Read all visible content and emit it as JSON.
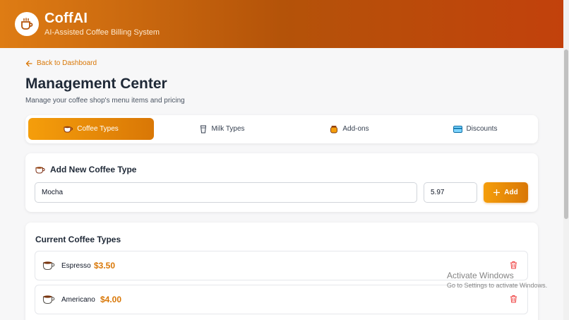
{
  "header": {
    "title": "CoffAI",
    "subtitle": "AI-Assisted Coffee Billing System",
    "logo_icon": "coffee-cup-icon"
  },
  "nav": {
    "back_label": "Back to Dashboard"
  },
  "page": {
    "title": "Management Center",
    "subtitle": "Manage your coffee shop's menu items and pricing"
  },
  "tabs": [
    {
      "label": "Coffee Types",
      "icon": "coffee-icon",
      "active": true
    },
    {
      "label": "Milk Types",
      "icon": "milk-icon",
      "active": false
    },
    {
      "label": "Add-ons",
      "icon": "honey-pot-icon",
      "active": false
    },
    {
      "label": "Discounts",
      "icon": "card-icon",
      "active": false
    }
  ],
  "add_form": {
    "title": "Add New Coffee Type",
    "name_value": "Mocha",
    "price_value": "5.97",
    "button_label": "Add"
  },
  "list": {
    "title": "Current Coffee Types",
    "items": [
      {
        "name": "Espresso",
        "price": "$3.50"
      },
      {
        "name": "Americano",
        "price": "$4.00"
      }
    ]
  },
  "watermark": {
    "line1": "Activate Windows",
    "line2": "Go to Settings to activate Windows."
  },
  "colors": {
    "accent": "#d97706",
    "accent_light": "#f59e0b",
    "header_end": "#c2410c",
    "delete": "#ef4444"
  }
}
